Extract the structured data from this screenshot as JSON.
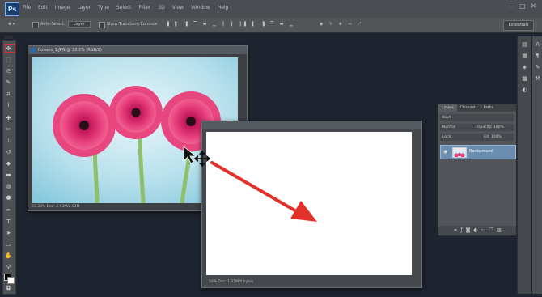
{
  "app": {
    "logo_text": "Ps",
    "menus": [
      "File",
      "Edit",
      "Image",
      "Layer",
      "Type",
      "Select",
      "Filter",
      "3D",
      "View",
      "Window",
      "Help"
    ]
  },
  "window_controls": [
    "—",
    "□",
    "✕"
  ],
  "options_bar": {
    "auto_select_label": "Auto-Select:",
    "auto_select_value": "Layer",
    "show_transform": "Show Transform Controls",
    "workspace": "Essentials"
  },
  "tools": [
    "move-tool",
    "marquee-tool",
    "lasso-tool",
    "quick-select-tool",
    "crop-tool",
    "eyedropper-tool",
    "healing-tool",
    "brush-tool",
    "stamp-tool",
    "history-brush-tool",
    "eraser-tool",
    "gradient-tool",
    "blur-tool",
    "dodge-tool",
    "pen-tool",
    "type-tool",
    "path-select-tool",
    "shape-tool",
    "hand-tool",
    "zoom-tool"
  ],
  "document1": {
    "tab_title": "flowers_1.JPG @ 33.3% (RGB/8)",
    "status": "33.33%     Doc: 2.93M/2.93M"
  },
  "document2": {
    "tab_title": "Untitled-1 @ 50% (RGB/8)",
    "status": "50%     Doc: 1.37M/0 bytes"
  },
  "layers_panel": {
    "tabs": [
      "Layers",
      "Channels",
      "Paths"
    ],
    "kind_label": "Kind",
    "blend_mode": "Normal",
    "opacity_label": "Opacity: 100%",
    "lock_label": "Lock:",
    "fill_label": "Fill: 100%",
    "layer_name": "Background",
    "footer_icons": [
      "link-icon",
      "fx-icon",
      "mask-icon",
      "adjustment-icon",
      "folder-icon",
      "new-layer-icon",
      "trash-icon"
    ]
  },
  "colors": {
    "annotation_red": "#e0322b",
    "canvas_bg": "#1f2530",
    "selected_layer": "#6b8db0"
  }
}
